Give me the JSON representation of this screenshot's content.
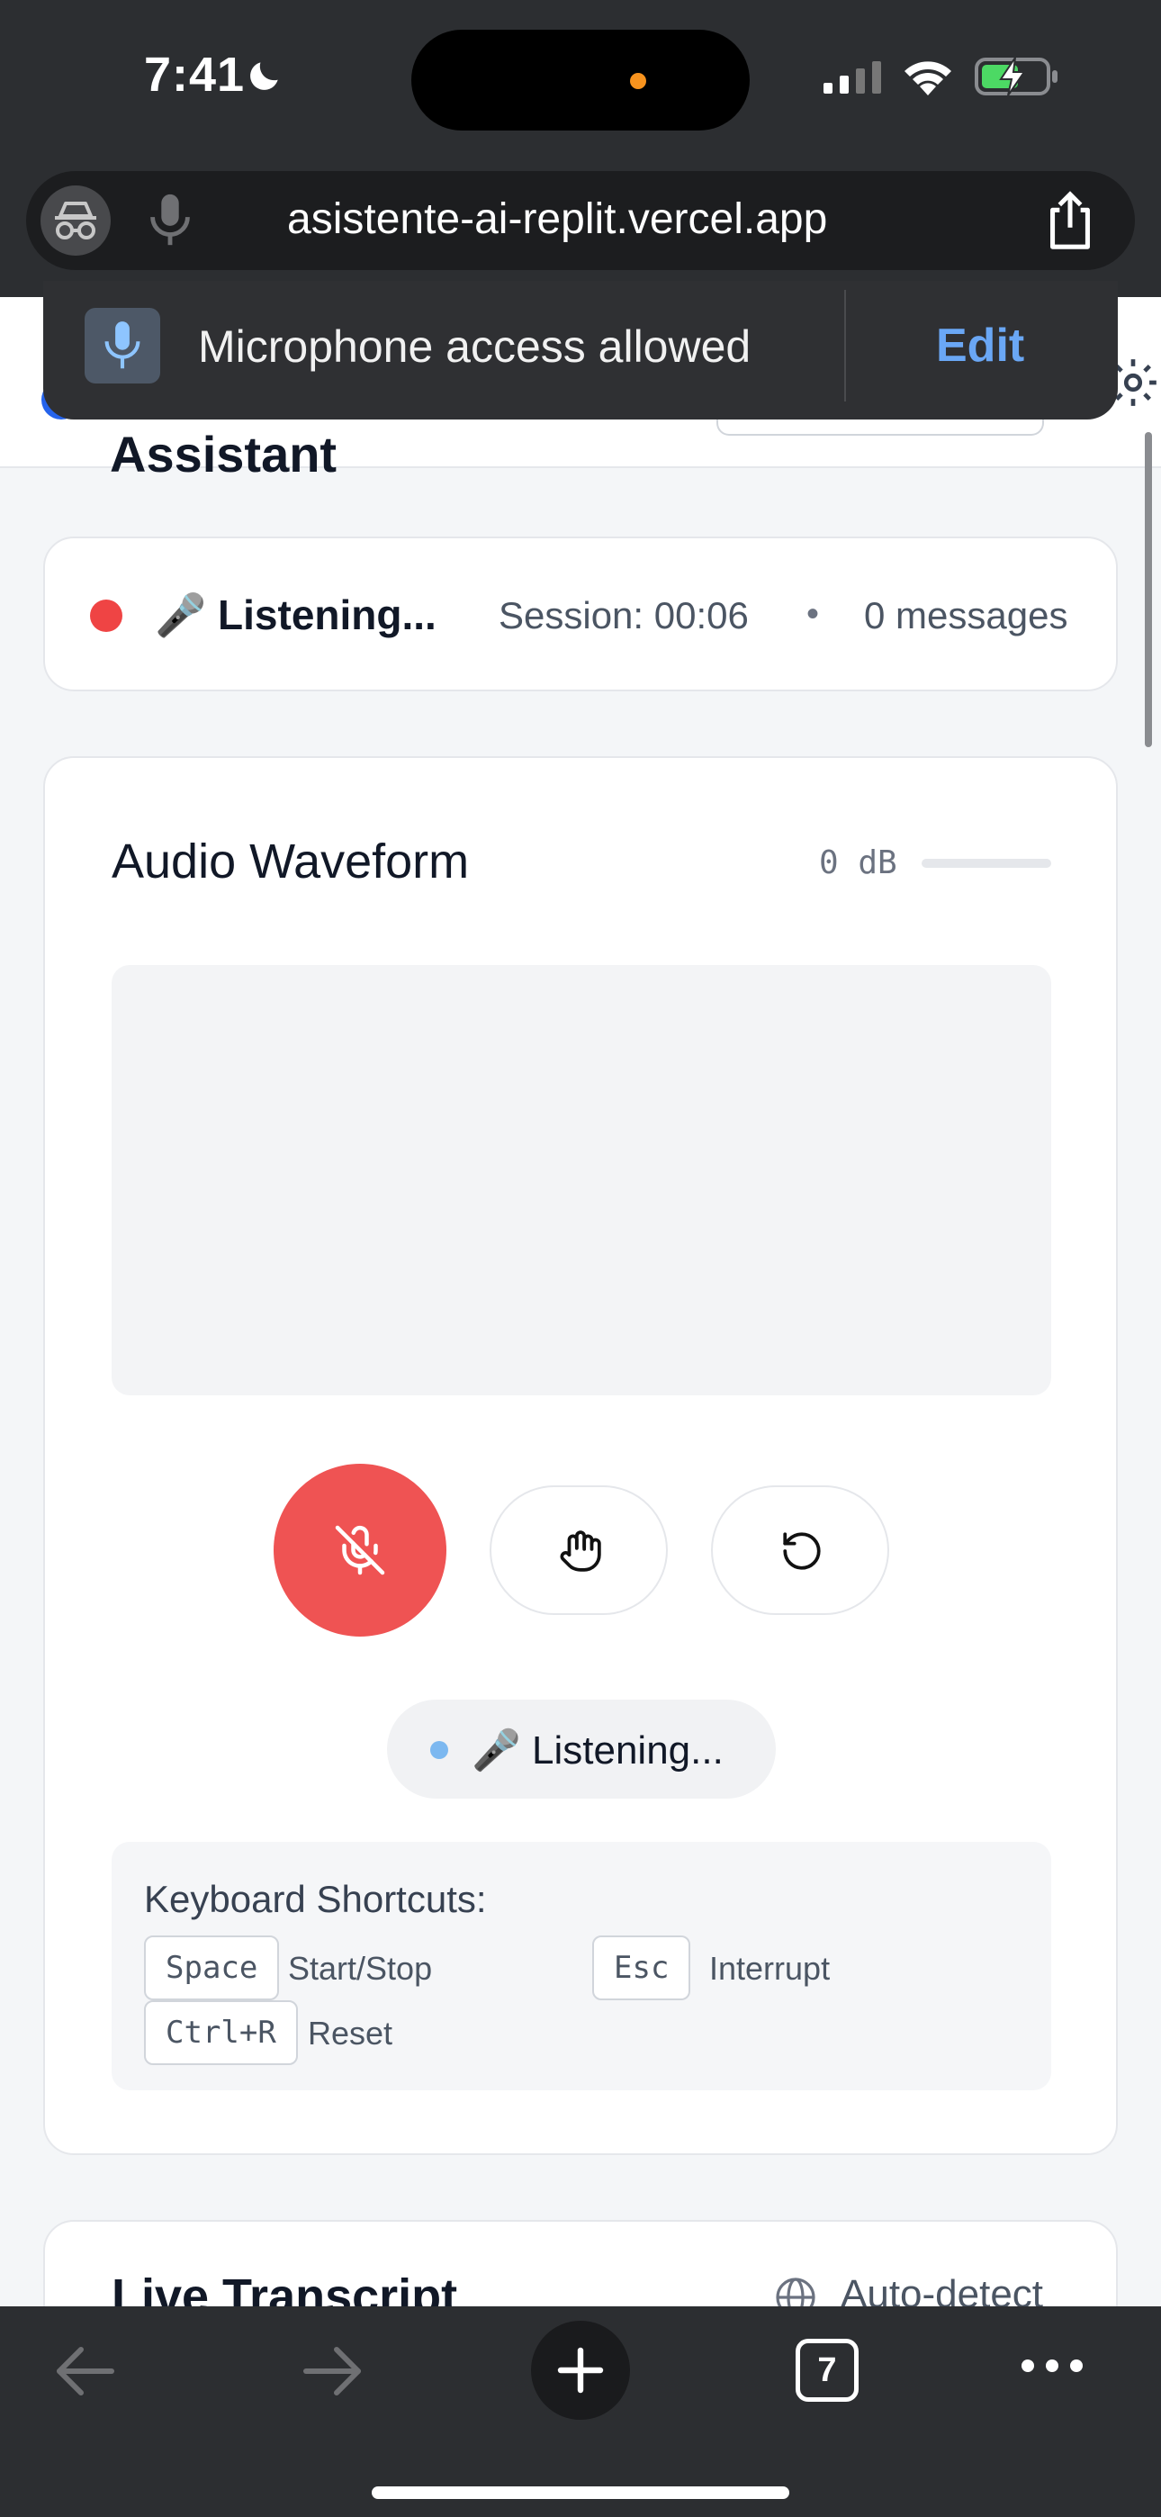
{
  "status_bar": {
    "time": "7:41"
  },
  "browser": {
    "url": "asistente-ai-replit.vercel.app",
    "tab_count": "7"
  },
  "mic_permission": {
    "message": "Microphone access allowed",
    "edit_label": "Edit"
  },
  "page": {
    "title": "Assistant"
  },
  "status": {
    "label": "🎤 Listening...",
    "session": "Session: 00:06",
    "separator": "•",
    "messages": "0 messages",
    "indicator_color": "#ef4444"
  },
  "waveform": {
    "title": "Audio Waveform",
    "db_label": "0 dB",
    "level_fraction": 0
  },
  "controls": {
    "mic_state": "muted",
    "mic_button_color": "#ef5353",
    "icons": [
      "mic-off-icon",
      "hand-icon",
      "reset-icon"
    ]
  },
  "listening_badge": {
    "label": "🎤 Listening..."
  },
  "shortcuts": {
    "title": "Keyboard Shortcuts:",
    "items": [
      {
        "key": "Space",
        "desc": "Start/Stop"
      },
      {
        "key": "Esc",
        "desc": "Interrupt"
      },
      {
        "key": "Ctrl+R",
        "desc": "Reset"
      }
    ]
  },
  "transcript": {
    "title": "Live Transcript",
    "language": "Auto-detect"
  },
  "colors": {
    "accent_blue": "#6aa7f5",
    "chrome_bg": "#2c2e31"
  }
}
